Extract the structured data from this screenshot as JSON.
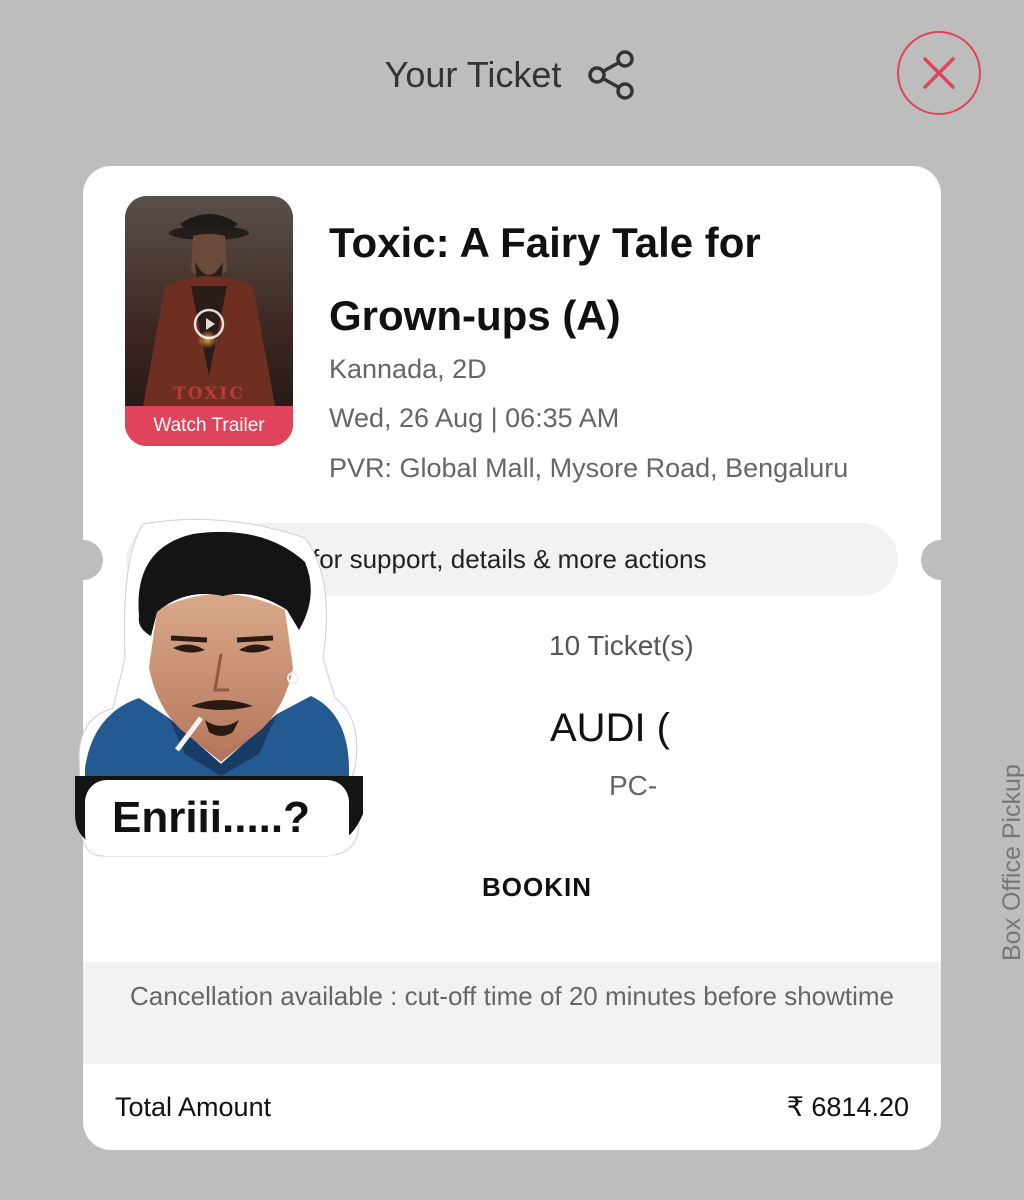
{
  "header": {
    "title": "Your Ticket",
    "share_icon": "share-icon",
    "close_icon": "close-icon"
  },
  "ticket": {
    "poster": {
      "title_text": "TOXIC",
      "watch_trailer_label": "Watch Trailer",
      "play_icon": "play-icon"
    },
    "movie_title": "Toxic: A Fairy Tale for Grown-ups (A)",
    "language_format": "Kannada, 2D",
    "datetime": "Wed, 26 Aug | 06:35 AM",
    "venue": "PVR: Global Mall, Mysore Road, Bengaluru",
    "support_text": "for support, details & more actions",
    "ticket_count": "10 Ticket(s)",
    "screen": "AUDI (",
    "seat": "PC-",
    "booking_label": "BOOKIN",
    "cancellation_note": "Cancellation available : cut-off time of 20 minutes before showtime",
    "total_label": "Total Amount",
    "total_value": "₹ 6814.20"
  },
  "sticker": {
    "text": "Enriii.....?"
  },
  "side_label": "Box Office Pickup",
  "colors": {
    "accent": "#e0445b",
    "background": "#bdbdbd",
    "card": "#ffffff",
    "band": "#f2f2f2"
  }
}
